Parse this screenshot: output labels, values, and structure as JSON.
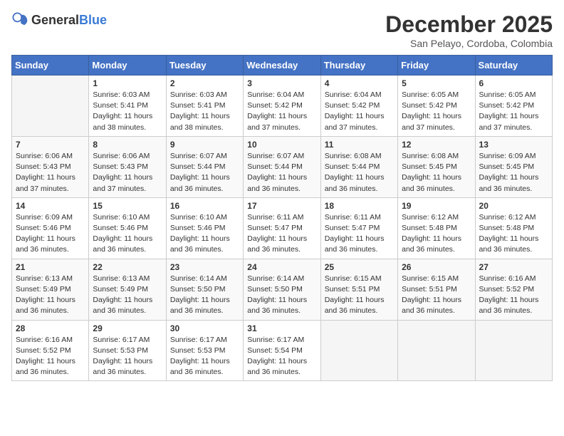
{
  "logo": {
    "general": "General",
    "blue": "Blue"
  },
  "title": "December 2025",
  "subtitle": "San Pelayo, Cordoba, Colombia",
  "days_of_week": [
    "Sunday",
    "Monday",
    "Tuesday",
    "Wednesday",
    "Thursday",
    "Friday",
    "Saturday"
  ],
  "weeks": [
    [
      {
        "day": "",
        "sunrise": "",
        "sunset": "",
        "daylight": ""
      },
      {
        "day": "1",
        "sunrise": "Sunrise: 6:03 AM",
        "sunset": "Sunset: 5:41 PM",
        "daylight": "Daylight: 11 hours and 38 minutes."
      },
      {
        "day": "2",
        "sunrise": "Sunrise: 6:03 AM",
        "sunset": "Sunset: 5:41 PM",
        "daylight": "Daylight: 11 hours and 38 minutes."
      },
      {
        "day": "3",
        "sunrise": "Sunrise: 6:04 AM",
        "sunset": "Sunset: 5:42 PM",
        "daylight": "Daylight: 11 hours and 37 minutes."
      },
      {
        "day": "4",
        "sunrise": "Sunrise: 6:04 AM",
        "sunset": "Sunset: 5:42 PM",
        "daylight": "Daylight: 11 hours and 37 minutes."
      },
      {
        "day": "5",
        "sunrise": "Sunrise: 6:05 AM",
        "sunset": "Sunset: 5:42 PM",
        "daylight": "Daylight: 11 hours and 37 minutes."
      },
      {
        "day": "6",
        "sunrise": "Sunrise: 6:05 AM",
        "sunset": "Sunset: 5:42 PM",
        "daylight": "Daylight: 11 hours and 37 minutes."
      }
    ],
    [
      {
        "day": "7",
        "sunrise": "Sunrise: 6:06 AM",
        "sunset": "Sunset: 5:43 PM",
        "daylight": "Daylight: 11 hours and 37 minutes."
      },
      {
        "day": "8",
        "sunrise": "Sunrise: 6:06 AM",
        "sunset": "Sunset: 5:43 PM",
        "daylight": "Daylight: 11 hours and 37 minutes."
      },
      {
        "day": "9",
        "sunrise": "Sunrise: 6:07 AM",
        "sunset": "Sunset: 5:44 PM",
        "daylight": "Daylight: 11 hours and 36 minutes."
      },
      {
        "day": "10",
        "sunrise": "Sunrise: 6:07 AM",
        "sunset": "Sunset: 5:44 PM",
        "daylight": "Daylight: 11 hours and 36 minutes."
      },
      {
        "day": "11",
        "sunrise": "Sunrise: 6:08 AM",
        "sunset": "Sunset: 5:44 PM",
        "daylight": "Daylight: 11 hours and 36 minutes."
      },
      {
        "day": "12",
        "sunrise": "Sunrise: 6:08 AM",
        "sunset": "Sunset: 5:45 PM",
        "daylight": "Daylight: 11 hours and 36 minutes."
      },
      {
        "day": "13",
        "sunrise": "Sunrise: 6:09 AM",
        "sunset": "Sunset: 5:45 PM",
        "daylight": "Daylight: 11 hours and 36 minutes."
      }
    ],
    [
      {
        "day": "14",
        "sunrise": "Sunrise: 6:09 AM",
        "sunset": "Sunset: 5:46 PM",
        "daylight": "Daylight: 11 hours and 36 minutes."
      },
      {
        "day": "15",
        "sunrise": "Sunrise: 6:10 AM",
        "sunset": "Sunset: 5:46 PM",
        "daylight": "Daylight: 11 hours and 36 minutes."
      },
      {
        "day": "16",
        "sunrise": "Sunrise: 6:10 AM",
        "sunset": "Sunset: 5:46 PM",
        "daylight": "Daylight: 11 hours and 36 minutes."
      },
      {
        "day": "17",
        "sunrise": "Sunrise: 6:11 AM",
        "sunset": "Sunset: 5:47 PM",
        "daylight": "Daylight: 11 hours and 36 minutes."
      },
      {
        "day": "18",
        "sunrise": "Sunrise: 6:11 AM",
        "sunset": "Sunset: 5:47 PM",
        "daylight": "Daylight: 11 hours and 36 minutes."
      },
      {
        "day": "19",
        "sunrise": "Sunrise: 6:12 AM",
        "sunset": "Sunset: 5:48 PM",
        "daylight": "Daylight: 11 hours and 36 minutes."
      },
      {
        "day": "20",
        "sunrise": "Sunrise: 6:12 AM",
        "sunset": "Sunset: 5:48 PM",
        "daylight": "Daylight: 11 hours and 36 minutes."
      }
    ],
    [
      {
        "day": "21",
        "sunrise": "Sunrise: 6:13 AM",
        "sunset": "Sunset: 5:49 PM",
        "daylight": "Daylight: 11 hours and 36 minutes."
      },
      {
        "day": "22",
        "sunrise": "Sunrise: 6:13 AM",
        "sunset": "Sunset: 5:49 PM",
        "daylight": "Daylight: 11 hours and 36 minutes."
      },
      {
        "day": "23",
        "sunrise": "Sunrise: 6:14 AM",
        "sunset": "Sunset: 5:50 PM",
        "daylight": "Daylight: 11 hours and 36 minutes."
      },
      {
        "day": "24",
        "sunrise": "Sunrise: 6:14 AM",
        "sunset": "Sunset: 5:50 PM",
        "daylight": "Daylight: 11 hours and 36 minutes."
      },
      {
        "day": "25",
        "sunrise": "Sunrise: 6:15 AM",
        "sunset": "Sunset: 5:51 PM",
        "daylight": "Daylight: 11 hours and 36 minutes."
      },
      {
        "day": "26",
        "sunrise": "Sunrise: 6:15 AM",
        "sunset": "Sunset: 5:51 PM",
        "daylight": "Daylight: 11 hours and 36 minutes."
      },
      {
        "day": "27",
        "sunrise": "Sunrise: 6:16 AM",
        "sunset": "Sunset: 5:52 PM",
        "daylight": "Daylight: 11 hours and 36 minutes."
      }
    ],
    [
      {
        "day": "28",
        "sunrise": "Sunrise: 6:16 AM",
        "sunset": "Sunset: 5:52 PM",
        "daylight": "Daylight: 11 hours and 36 minutes."
      },
      {
        "day": "29",
        "sunrise": "Sunrise: 6:17 AM",
        "sunset": "Sunset: 5:53 PM",
        "daylight": "Daylight: 11 hours and 36 minutes."
      },
      {
        "day": "30",
        "sunrise": "Sunrise: 6:17 AM",
        "sunset": "Sunset: 5:53 PM",
        "daylight": "Daylight: 11 hours and 36 minutes."
      },
      {
        "day": "31",
        "sunrise": "Sunrise: 6:17 AM",
        "sunset": "Sunset: 5:54 PM",
        "daylight": "Daylight: 11 hours and 36 minutes."
      },
      {
        "day": "",
        "sunrise": "",
        "sunset": "",
        "daylight": ""
      },
      {
        "day": "",
        "sunrise": "",
        "sunset": "",
        "daylight": ""
      },
      {
        "day": "",
        "sunrise": "",
        "sunset": "",
        "daylight": ""
      }
    ]
  ]
}
